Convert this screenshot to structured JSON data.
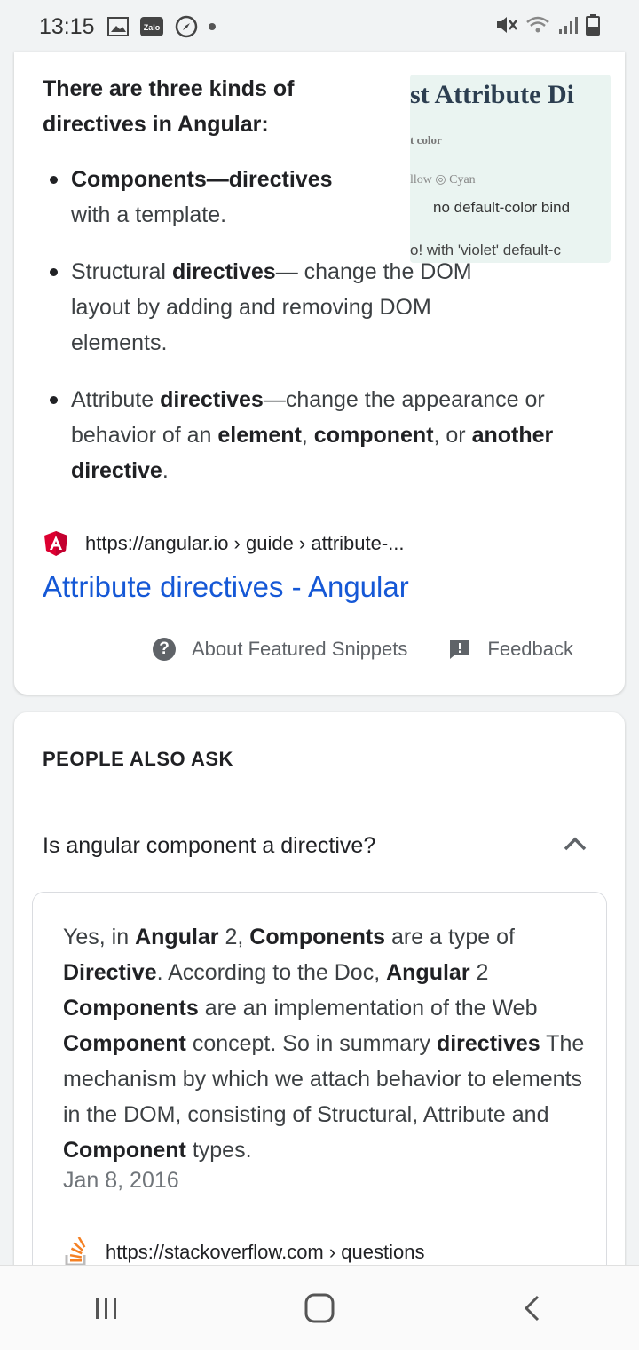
{
  "status_bar": {
    "time": "13:15",
    "icons": [
      "image-icon",
      "zalo-icon",
      "compass-icon",
      "mute-icon",
      "wifi-icon",
      "signal-icon",
      "battery-icon"
    ],
    "zalo_label": "Zalo"
  },
  "snippet": {
    "intro": "There are three kinds of directives in Angular:",
    "thumbnail": {
      "line1": "st Attribute Di",
      "line2": "t color",
      "line3": "llow  ◎ Cyan",
      "line4": "no default-color bind",
      "line5": "o!  with 'violet' default-c"
    },
    "bullets": [
      {
        "bold": "Components—directives",
        "rest": " with a template."
      },
      {
        "pre": "Structural ",
        "bold": "directives",
        "rest": "— change the DOM layout by adding and removing DOM elements."
      },
      {
        "pre": "Attribute ",
        "bold": "directives",
        "rest": "—change the appearance or behavior of an ",
        "b2": "element",
        "r2": ", ",
        "b3": "component",
        "r3": ", or ",
        "b4": "another directive",
        "r4": "."
      }
    ],
    "source_url": "https://angular.io › guide › attribute-...",
    "title": "Attribute directives - Angular",
    "about_label": "About Featured Snippets",
    "feedback_label": "Feedback"
  },
  "people_also_ask": {
    "heading": "PEOPLE ALSO ASK",
    "question": "Is angular component a directive?",
    "answer_date": "Jan 8, 2016",
    "source_url": "https://stackoverflow.com › questions"
  },
  "colors": {
    "link": "#1558d6",
    "angular_red": "#dd0031",
    "stackoverflow_orange": "#f48024"
  }
}
